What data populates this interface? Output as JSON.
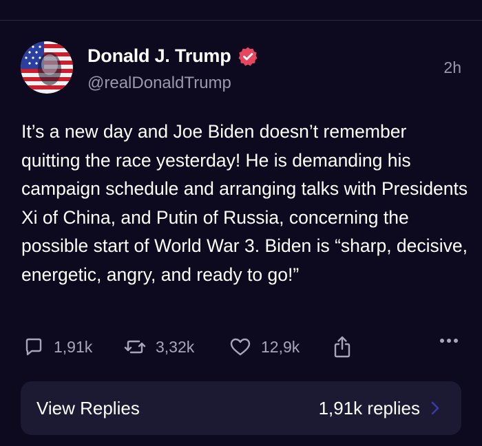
{
  "post": {
    "author_name": "Donald J. Trump",
    "author_handle": "@realDonaldTrump",
    "time_ago": "2h",
    "text": "It’s a new day and Joe Biden doesn’t remember quitting the race yesterday! He is demanding his campaign schedule and arranging talks with Presidents Xi of China, and Putin of Russia, concerning the possible start of World War 3. Biden is “sharp, decisive, energetic, angry, and ready to go!”"
  },
  "actions": {
    "replies_count": "1,91k",
    "reposts_count": "3,32k",
    "likes_count": "12,9k",
    "icons": [
      "reply-icon",
      "repost-icon",
      "heart-icon",
      "share-icon",
      "more-icon"
    ]
  },
  "replies_bar": {
    "label": "View Replies",
    "count_text": "1,91k replies"
  },
  "colors": {
    "background": "#0d0a1f",
    "card": "#1c1933",
    "muted_text": "#9b98ad",
    "verified_badge": "#e8465f",
    "chevron": "#3d3aa8"
  }
}
